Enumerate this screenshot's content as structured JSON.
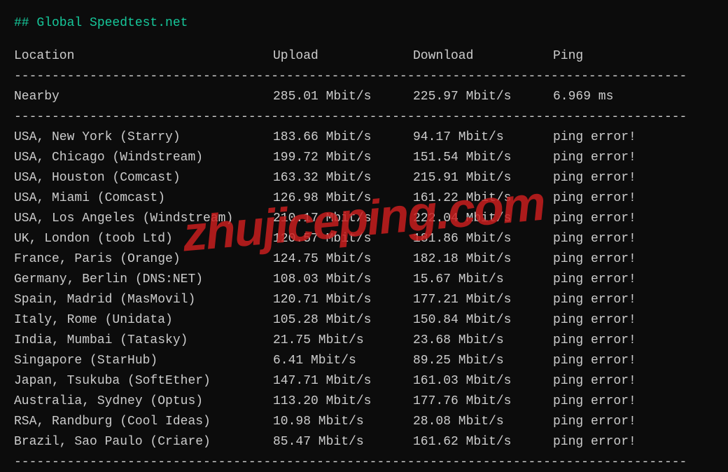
{
  "title": "## Global Speedtest.net",
  "headers": {
    "location": "Location",
    "upload": "Upload",
    "download": "Download",
    "ping": "Ping"
  },
  "nearby": {
    "location": "Nearby",
    "upload": "285.01 Mbit/s",
    "download": "225.97 Mbit/s",
    "ping": "6.969 ms"
  },
  "rows": [
    {
      "location": "USA, New York (Starry)",
      "upload": "183.66 Mbit/s",
      "download": "94.17 Mbit/s",
      "ping": "ping error!"
    },
    {
      "location": "USA, Chicago (Windstream)",
      "upload": "199.72 Mbit/s",
      "download": "151.54 Mbit/s",
      "ping": "ping error!"
    },
    {
      "location": "USA, Houston (Comcast)",
      "upload": "163.32 Mbit/s",
      "download": "215.91 Mbit/s",
      "ping": "ping error!"
    },
    {
      "location": "USA, Miami (Comcast)",
      "upload": "126.98 Mbit/s",
      "download": "161.22 Mbit/s",
      "ping": "ping error!"
    },
    {
      "location": "USA, Los Angeles (Windstream)",
      "upload": "210.17 Mbit/s",
      "download": "222.04 Mbit/s",
      "ping": "ping error!"
    },
    {
      "location": "UK, London (toob Ltd)",
      "upload": "120.57 Mbit/s",
      "download": "181.86 Mbit/s",
      "ping": "ping error!"
    },
    {
      "location": "France, Paris (Orange)",
      "upload": "124.75 Mbit/s",
      "download": "182.18 Mbit/s",
      "ping": "ping error!"
    },
    {
      "location": "Germany, Berlin (DNS:NET)",
      "upload": "108.03 Mbit/s",
      "download": "15.67 Mbit/s",
      "ping": "ping error!"
    },
    {
      "location": "Spain, Madrid (MasMovil)",
      "upload": "120.71 Mbit/s",
      "download": "177.21 Mbit/s",
      "ping": "ping error!"
    },
    {
      "location": "Italy, Rome (Unidata)",
      "upload": "105.28 Mbit/s",
      "download": "150.84 Mbit/s",
      "ping": "ping error!"
    },
    {
      "location": "India, Mumbai (Tatasky)",
      "upload": "21.75 Mbit/s",
      "download": "23.68 Mbit/s",
      "ping": "ping error!"
    },
    {
      "location": "Singapore (StarHub)",
      "upload": "6.41 Mbit/s",
      "download": "89.25 Mbit/s",
      "ping": "ping error!"
    },
    {
      "location": "Japan, Tsukuba (SoftEther)",
      "upload": "147.71 Mbit/s",
      "download": "161.03 Mbit/s",
      "ping": "ping error!"
    },
    {
      "location": "Australia, Sydney (Optus)",
      "upload": "113.20 Mbit/s",
      "download": "177.76 Mbit/s",
      "ping": "ping error!"
    },
    {
      "location": "RSA, Randburg (Cool Ideas)",
      "upload": "10.98 Mbit/s",
      "download": "28.08 Mbit/s",
      "ping": "ping error!"
    },
    {
      "location": "Brazil, Sao Paulo (Criare)",
      "upload": "85.47 Mbit/s",
      "download": "161.62 Mbit/s",
      "ping": "ping error!"
    }
  ],
  "separator": "-----------------------------------------------------------------------------------------",
  "watermark": "zhujiceping.com"
}
